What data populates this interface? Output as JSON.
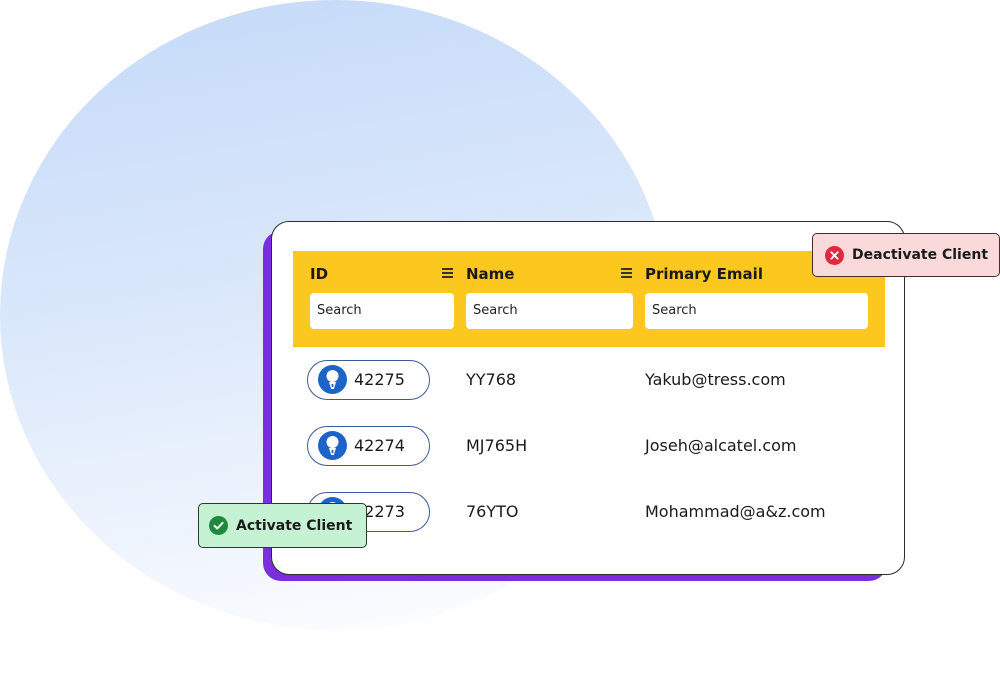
{
  "table": {
    "columns": [
      {
        "label": "ID",
        "search_placeholder": "Search"
      },
      {
        "label": "Name",
        "search_placeholder": "Search"
      },
      {
        "label": "Primary Email",
        "search_placeholder": "Search"
      }
    ],
    "rows": [
      {
        "id": "42275",
        "name": "YY768",
        "email": "Yakub@tress.com"
      },
      {
        "id": "42274",
        "name": "MJ765H",
        "email": "Joseh@alcatel.com"
      },
      {
        "id": "42273",
        "name": "76YTO",
        "email": "Mohammad@a&z.com"
      }
    ]
  },
  "actions": {
    "deactivate_label": "Deactivate Client",
    "activate_label": "Activate Client"
  },
  "icons": {
    "column_menu": "hamburger-menu-icon",
    "avatar": "user-avatar-icon",
    "deactivate": "x-circle-icon",
    "activate": "check-circle-icon"
  },
  "colors": {
    "header_background": "#fcc820",
    "card_accent": "#7b2fdc",
    "avatar": "#1c64c8",
    "deactivate_bg": "#fad9db",
    "deactivate_icon": "#e0293e",
    "activate_bg": "#c4f2d2",
    "activate_icon": "#1f8a3c"
  }
}
